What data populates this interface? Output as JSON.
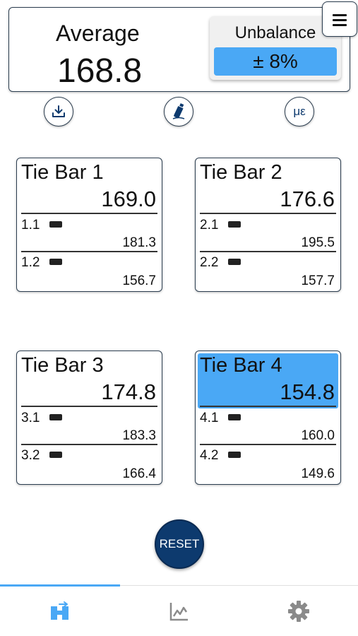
{
  "summary": {
    "average_label": "Average",
    "average_value": "168.8",
    "unbalance_label": "Unbalance",
    "unbalance_value": "± 8%"
  },
  "actions": {
    "download_icon": "download-icon",
    "bottle_icon": "bottle-icon",
    "micro_strain_label": "με"
  },
  "tie_bars": [
    {
      "title": "Tie Bar 1",
      "value": "169.0",
      "channels": [
        {
          "label": "1.1",
          "value": "181.3"
        },
        {
          "label": "1.2",
          "value": "156.7"
        }
      ]
    },
    {
      "title": "Tie Bar 2",
      "value": "176.6",
      "channels": [
        {
          "label": "2.1",
          "value": "195.5"
        },
        {
          "label": "2.2",
          "value": "157.7"
        }
      ]
    },
    {
      "title": "Tie Bar 3",
      "value": "174.8",
      "channels": [
        {
          "label": "3.1",
          "value": "183.3"
        },
        {
          "label": "3.2",
          "value": "166.4"
        }
      ]
    },
    {
      "title": "Tie Bar 4",
      "value": "154.8",
      "channels": [
        {
          "label": "4.1",
          "value": "160.0"
        },
        {
          "label": "4.2",
          "value": "149.6"
        }
      ]
    }
  ],
  "reset_label": "RESET",
  "tabs": [
    {
      "icon": "tiebar-view-icon",
      "active": true
    },
    {
      "icon": "chart-icon",
      "active": false
    },
    {
      "icon": "gear-icon",
      "active": false
    }
  ],
  "colors": {
    "accent": "#4aa8f5",
    "primary_dark": "#0d3a6e",
    "border": "#2c3e50",
    "tab_icon_inactive": "#8a8a8a"
  }
}
